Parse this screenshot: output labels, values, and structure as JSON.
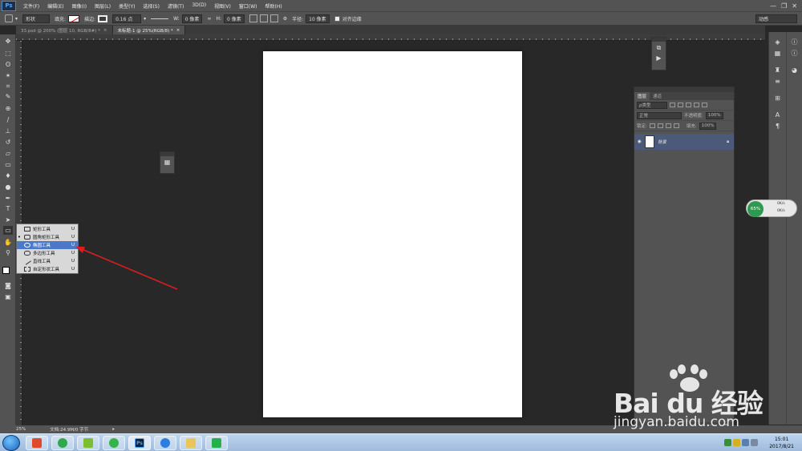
{
  "app": {
    "logo": "Ps"
  },
  "menu": [
    "文件(F)",
    "编辑(E)",
    "图像(I)",
    "图层(L)",
    "类型(Y)",
    "选择(S)",
    "滤镜(T)",
    "3D(D)",
    "视图(V)",
    "窗口(W)",
    "帮助(H)"
  ],
  "window_controls": {
    "minimize": "—",
    "restore": "❐",
    "close": "✕"
  },
  "options": {
    "mode": "形状",
    "fill_label": "填充:",
    "stroke_label": "描边:",
    "stroke_size": "0.16 点",
    "w_label": "W:",
    "w_value": "0 像素",
    "h_label": "H:",
    "h_value": "0 像素",
    "radius_label": "半径:",
    "radius_value": "10 像素",
    "align_label": "对齐边缘",
    "workspace": "动感"
  },
  "tabs": [
    {
      "label": "33.psd @ 200% (图层 10, RGB/8#) *",
      "close": "×"
    },
    {
      "label": "未标题-1 @ 25%(RGB/8) *",
      "close": "×"
    }
  ],
  "toolbox": {
    "icons": [
      "move-icon",
      "marquee-icon",
      "lasso-icon",
      "magic-wand-icon",
      "crop-icon",
      "eyedropper-icon",
      "healing-icon",
      "brush-icon",
      "stamp-icon",
      "history-brush-icon",
      "eraser-icon",
      "gradient-icon",
      "blur-icon",
      "dodge-icon",
      "pen-icon",
      "type-icon",
      "path-select-icon",
      "shape-icon",
      "hand-icon",
      "zoom-icon"
    ]
  },
  "flyout": [
    {
      "label": "矩形工具",
      "key": "U",
      "active": false
    },
    {
      "label": "圆角矩形工具",
      "key": "U",
      "active": true
    },
    {
      "label": "椭圆工具",
      "key": "U",
      "active": false
    },
    {
      "label": "多边形工具",
      "key": "U",
      "active": false
    },
    {
      "label": "直线工具",
      "key": "U",
      "active": false
    },
    {
      "label": "自定形状工具",
      "key": "U",
      "active": false
    }
  ],
  "layers_panel": {
    "tabs": [
      "图层",
      "通道"
    ],
    "kind": "ρ类型",
    "blend_mode": "正常",
    "opacity_label": "不透明度:",
    "opacity_value": "100%",
    "lock_label": "锁定:",
    "fill_label": "填充:",
    "fill_value": "100%",
    "layer_name": "背景"
  },
  "speed_widget": {
    "percent": "65%",
    "up": "0K/s",
    "down": "0K/s"
  },
  "status": {
    "zoom": "25%",
    "doc": "文档:24.9M/0 字节"
  },
  "taskbar": {
    "apps": [
      "360-icon",
      "browser-icon",
      "player-icon",
      "wechat-icon",
      "photoshop-icon",
      "cloud-icon",
      "folder-icon",
      "wps-icon"
    ],
    "ps_glyph": "Ps",
    "time": "15:01",
    "date": "2017/8/21"
  },
  "watermark": {
    "text": "Bai du 经验",
    "url": "jingyan.baidu.com"
  },
  "annotation": {
    "arrow_color": "#d81e1e"
  }
}
